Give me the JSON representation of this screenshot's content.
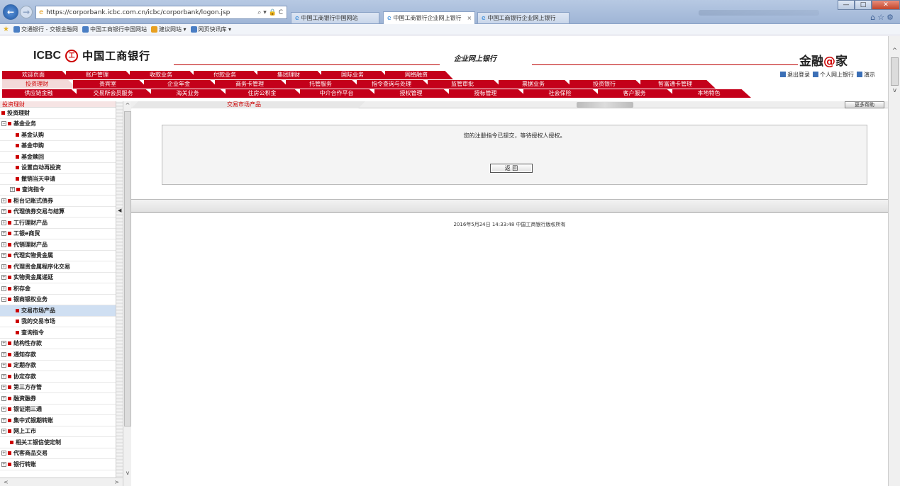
{
  "browser": {
    "url": "https://corporbank.icbc.com.cn/icbc/corporbank/logon.jsp",
    "address_controls": "⌕ ▾ 🔒 C",
    "tabs": [
      {
        "label": "中国工商银行中国网站"
      },
      {
        "label": "中国工商银行企业网上银行"
      },
      {
        "label": "中国工商银行企业网上银行"
      }
    ],
    "favorites": [
      "交通银行 - 交银金融网",
      "中国工商银行中国网站",
      "建议网站 ▾",
      "网页快讯库 ▾"
    ],
    "window_controls": [
      "—",
      "□",
      "✕"
    ]
  },
  "header": {
    "logo_en": "ICBC",
    "logo_seal": "工",
    "logo_cn": "中国工商银行",
    "site_name": "企业网上银行",
    "brand_pre": "金融",
    "brand_at": "@",
    "brand_post": "家",
    "links": [
      "退出登录",
      "个人网上银行",
      "演示"
    ]
  },
  "menu": {
    "row1": [
      "欢迎页面",
      "账户管理",
      "收款业务",
      "付款业务",
      "集团理财",
      "国际业务",
      "网络融资"
    ],
    "row2": [
      "投资理财",
      "贵宾室",
      "企业年金",
      "商务卡管理",
      "托管服务",
      "指令查询与处理",
      "监管审批",
      "票据业务",
      "投资银行",
      "智富通卡管理"
    ],
    "row3": [
      "供应链金融",
      "交易所会员服务",
      "海关业务",
      "住房公积金",
      "中介合作平台",
      "授权管理",
      "授标管理",
      "社会保险",
      "客户服务",
      "本地特色"
    ]
  },
  "sidebar": {
    "header": "投资理财",
    "items": [
      {
        "label": "投资理财",
        "level": 0,
        "pm": "",
        "dot": true
      },
      {
        "label": "基金业务",
        "level": 0,
        "pm": "−",
        "dot": true
      },
      {
        "label": "基金认购",
        "level": 2,
        "pm": "",
        "dot": true
      },
      {
        "label": "基金申购",
        "level": 2,
        "pm": "",
        "dot": true
      },
      {
        "label": "基金赎回",
        "level": 2,
        "pm": "",
        "dot": true
      },
      {
        "label": "设置自动再投资",
        "level": 2,
        "pm": "",
        "dot": true
      },
      {
        "label": "撤销当天申请",
        "level": 2,
        "pm": "",
        "dot": true
      },
      {
        "label": "查询指令",
        "level": 1,
        "pm": "+",
        "dot": true
      },
      {
        "label": "柜台记账式债券",
        "level": 0,
        "pm": "+",
        "dot": true
      },
      {
        "label": "代理债券交易与结算",
        "level": 0,
        "pm": "+",
        "dot": true
      },
      {
        "label": "工行理财产品",
        "level": 0,
        "pm": "+",
        "dot": true
      },
      {
        "label": "工银e商贸",
        "level": 0,
        "pm": "+",
        "dot": true
      },
      {
        "label": "代销理财产品",
        "level": 0,
        "pm": "+",
        "dot": true
      },
      {
        "label": "代理实物贵金属",
        "level": 0,
        "pm": "+",
        "dot": true
      },
      {
        "label": "代理贵金属程序化交易",
        "level": 0,
        "pm": "+",
        "dot": true
      },
      {
        "label": "实物贵金属递延",
        "level": 0,
        "pm": "+",
        "dot": true
      },
      {
        "label": "积存金",
        "level": 0,
        "pm": "+",
        "dot": true
      },
      {
        "label": "银商银权业务",
        "level": 0,
        "pm": "−",
        "dot": true
      },
      {
        "label": "交易市场产品",
        "level": 2,
        "pm": "",
        "dot": true,
        "selected": true
      },
      {
        "label": "我的交易市场",
        "level": 2,
        "pm": "",
        "dot": true
      },
      {
        "label": "查询指令",
        "level": 2,
        "pm": "",
        "dot": true
      },
      {
        "label": "结构性存款",
        "level": 0,
        "pm": "+",
        "dot": true
      },
      {
        "label": "通知存款",
        "level": 0,
        "pm": "+",
        "dot": true
      },
      {
        "label": "定期存款",
        "level": 0,
        "pm": "+",
        "dot": true
      },
      {
        "label": "协定存款",
        "level": 0,
        "pm": "+",
        "dot": true
      },
      {
        "label": "第三方存管",
        "level": 0,
        "pm": "+",
        "dot": true
      },
      {
        "label": "融资融券",
        "level": 0,
        "pm": "+",
        "dot": true
      },
      {
        "label": "银证期三通",
        "level": 0,
        "pm": "+",
        "dot": true
      },
      {
        "label": "集中式银期转账",
        "level": 0,
        "pm": "+",
        "dot": true
      },
      {
        "label": "网上工市",
        "level": 0,
        "pm": "+",
        "dot": true
      },
      {
        "label": "相关工银信使定制",
        "level": 1,
        "pm": "",
        "dot": true
      },
      {
        "label": "代客商品交易",
        "level": 0,
        "pm": "+",
        "dot": true
      },
      {
        "label": "银行转账",
        "level": 0,
        "pm": "+",
        "dot": true
      }
    ]
  },
  "main": {
    "breadcrumb": "交易市场产品",
    "help_button": "更多帮助",
    "message": "您的注册指令已提交，等待授权人授权。",
    "return_button": "返 回",
    "copyright": "2016年5月24日 14:33:48    中国工商银行版权所有"
  },
  "colors": {
    "menu_red": "#c4001a",
    "accent_red": "#cc0000"
  }
}
